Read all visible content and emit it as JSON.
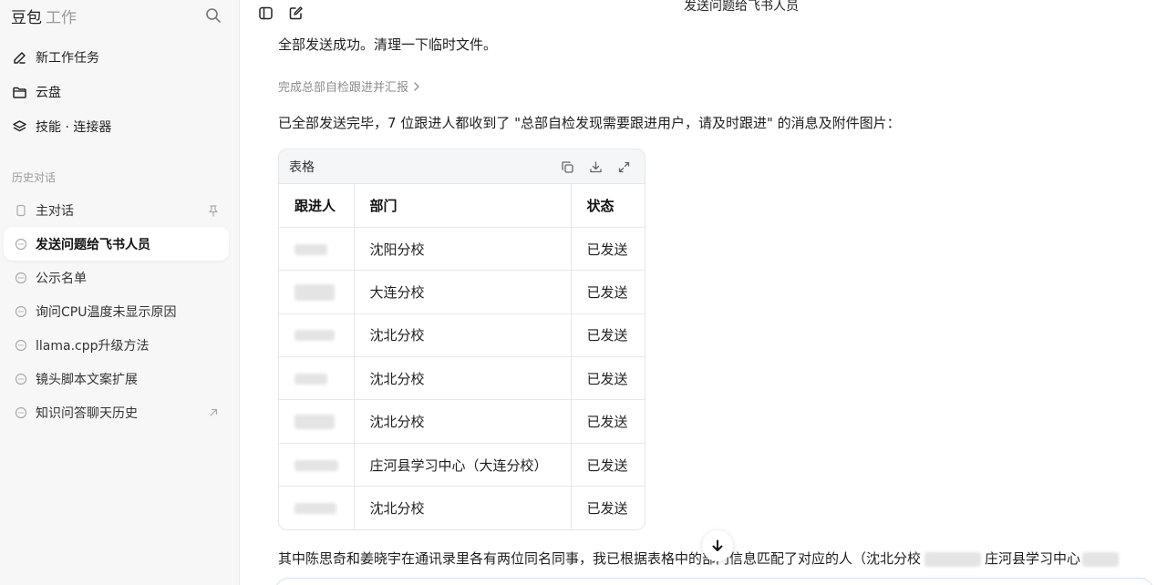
{
  "sidebar": {
    "brand": "豆包",
    "brand_sub": "工作",
    "nav": [
      {
        "label": "新工作任务",
        "icon": "edit-icon"
      },
      {
        "label": "云盘",
        "icon": "folder-icon"
      },
      {
        "label": "技能 · 连接器",
        "icon": "layers-icon"
      }
    ],
    "history_label": "历史对话",
    "history": [
      {
        "label": "主对话",
        "trailing_icon": "pin-icon"
      },
      {
        "label": "发送问题给飞书人员",
        "active": true
      },
      {
        "label": "公示名单"
      },
      {
        "label": "询问CPU温度未显示原因"
      },
      {
        "label": "llama.cpp升级方法"
      },
      {
        "label": "镜头脚本文案扩展"
      },
      {
        "label": "知识问答聊天历史",
        "trailing_icon": "external-link-icon"
      }
    ]
  },
  "topbar": {
    "title": "发送问题给飞书人员"
  },
  "main": {
    "line1": "全部发送成功。清理一下临时文件。",
    "step_link": "完成总部自检跟进并汇报",
    "line2": "已全部发送完毕，7 位跟进人都收到了 \"总部自检发现需要跟进用户，请及时跟进\" 的消息及附件图片：",
    "table": {
      "title": "表格",
      "headers": [
        "跟进人",
        "部门",
        "状态"
      ],
      "rows": [
        {
          "dept": "沈阳分校",
          "status": "已发送"
        },
        {
          "dept": "大连分校",
          "status": "已发送"
        },
        {
          "dept": "沈北分校",
          "status": "已发送"
        },
        {
          "dept": "沈北分校",
          "status": "已发送"
        },
        {
          "dept": "沈北分校",
          "status": "已发送"
        },
        {
          "dept": "庄河县学习中心（大连分校）",
          "status": "已发送"
        },
        {
          "dept": "沈北分校",
          "status": "已发送"
        }
      ]
    },
    "bottom_line_a": "其中陈思奇和姜晓宇在通讯录里各有两位同名同事，我已根据表格中的部门信息匹配了对应的人（沈北分校",
    "bottom_line_b": "庄河县学习中心"
  },
  "colors": {
    "sidebar_bg": "#f7f7f8",
    "text": "#1f1f1f",
    "muted": "#9a9a9a",
    "input_border": "#cfe0ff"
  }
}
